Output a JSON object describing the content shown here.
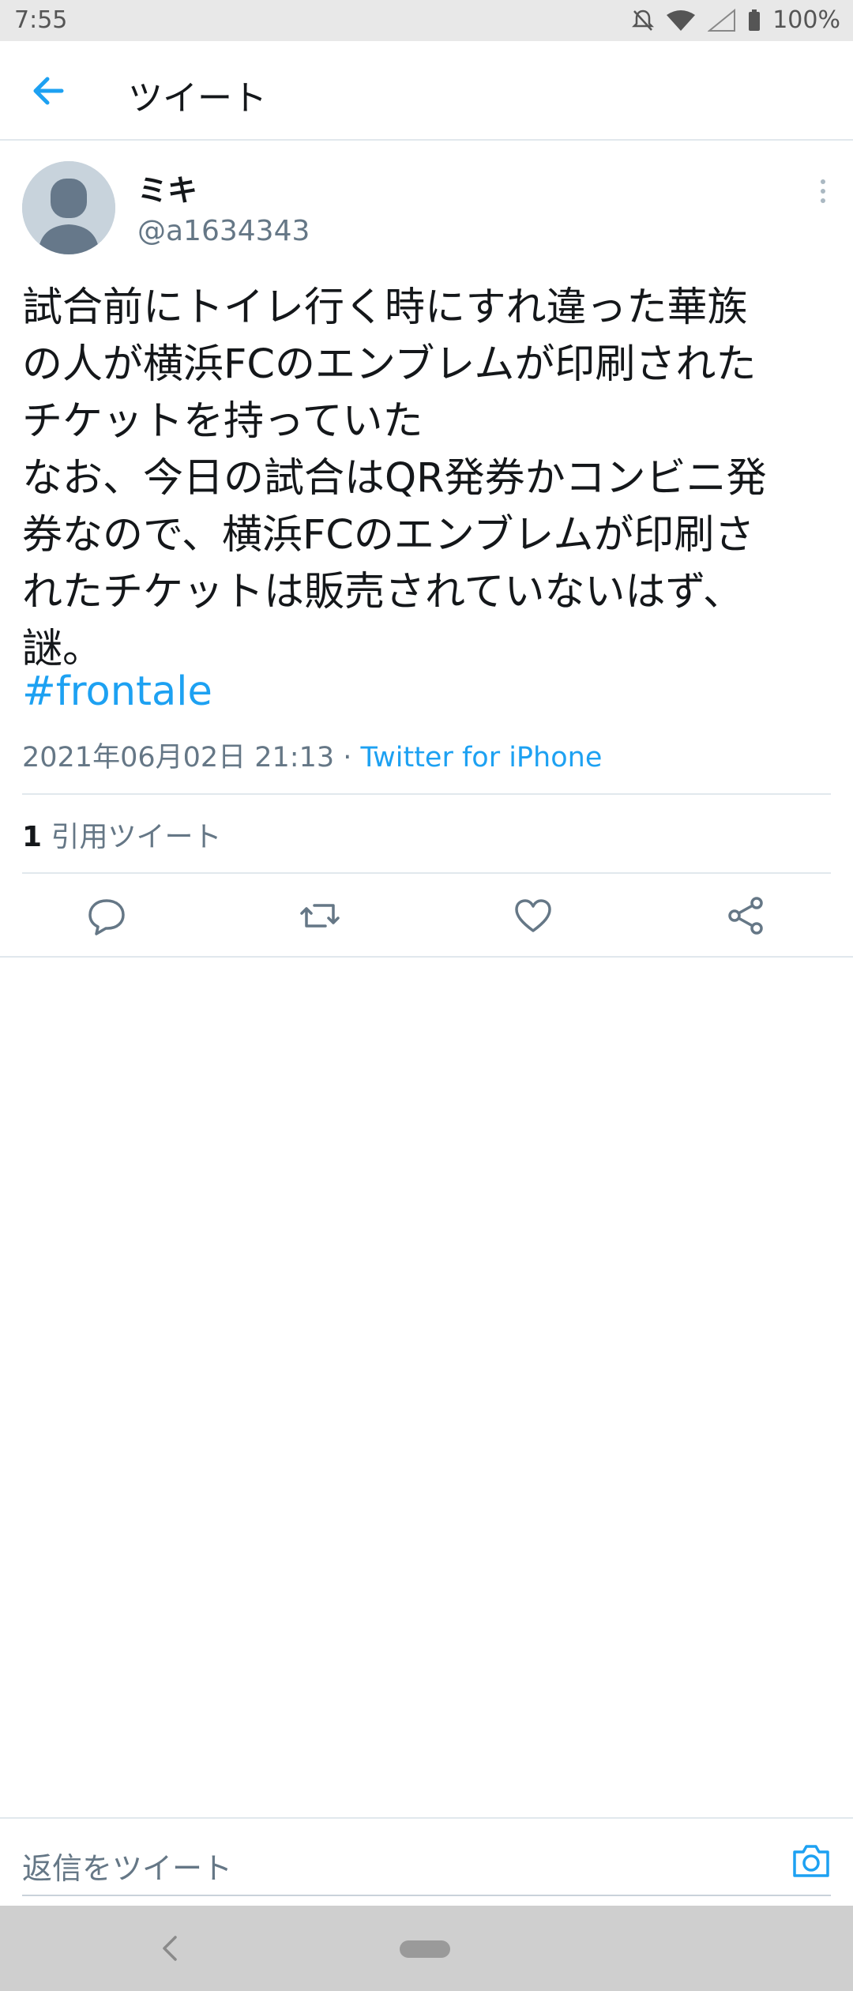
{
  "status_bar": {
    "time": "7:55",
    "battery": "100%"
  },
  "header": {
    "title": "ツイート"
  },
  "author": {
    "display_name": "ミキ",
    "username": "@a1634343"
  },
  "tweet": {
    "text": "試合前にトイレ行く時にすれ違った華族\nの人が横浜FCのエンブレムが印刷された\nチケットを持っていた\nなお、今日の試合はQR発券かコンビニ発\n券なので、横浜FCのエンブレムが印刷さ\nれたチケットは販売されていないはず、\n謎。",
    "hashtag": "#frontale",
    "timestamp": "2021年06月02日 21:13",
    "separator": " · ",
    "client": "Twitter for iPhone"
  },
  "stats": {
    "quote_count": "1",
    "quote_label": "引用ツイート"
  },
  "actions": [
    "reply-icon",
    "retweet-icon",
    "like-icon",
    "share-icon"
  ],
  "reply_bar": {
    "placeholder": "返信をツイート"
  },
  "colors": {
    "accent": "#1da1f2",
    "secondary_text": "#657786",
    "primary_text": "#14171a",
    "divider": "#e1e8ed"
  }
}
